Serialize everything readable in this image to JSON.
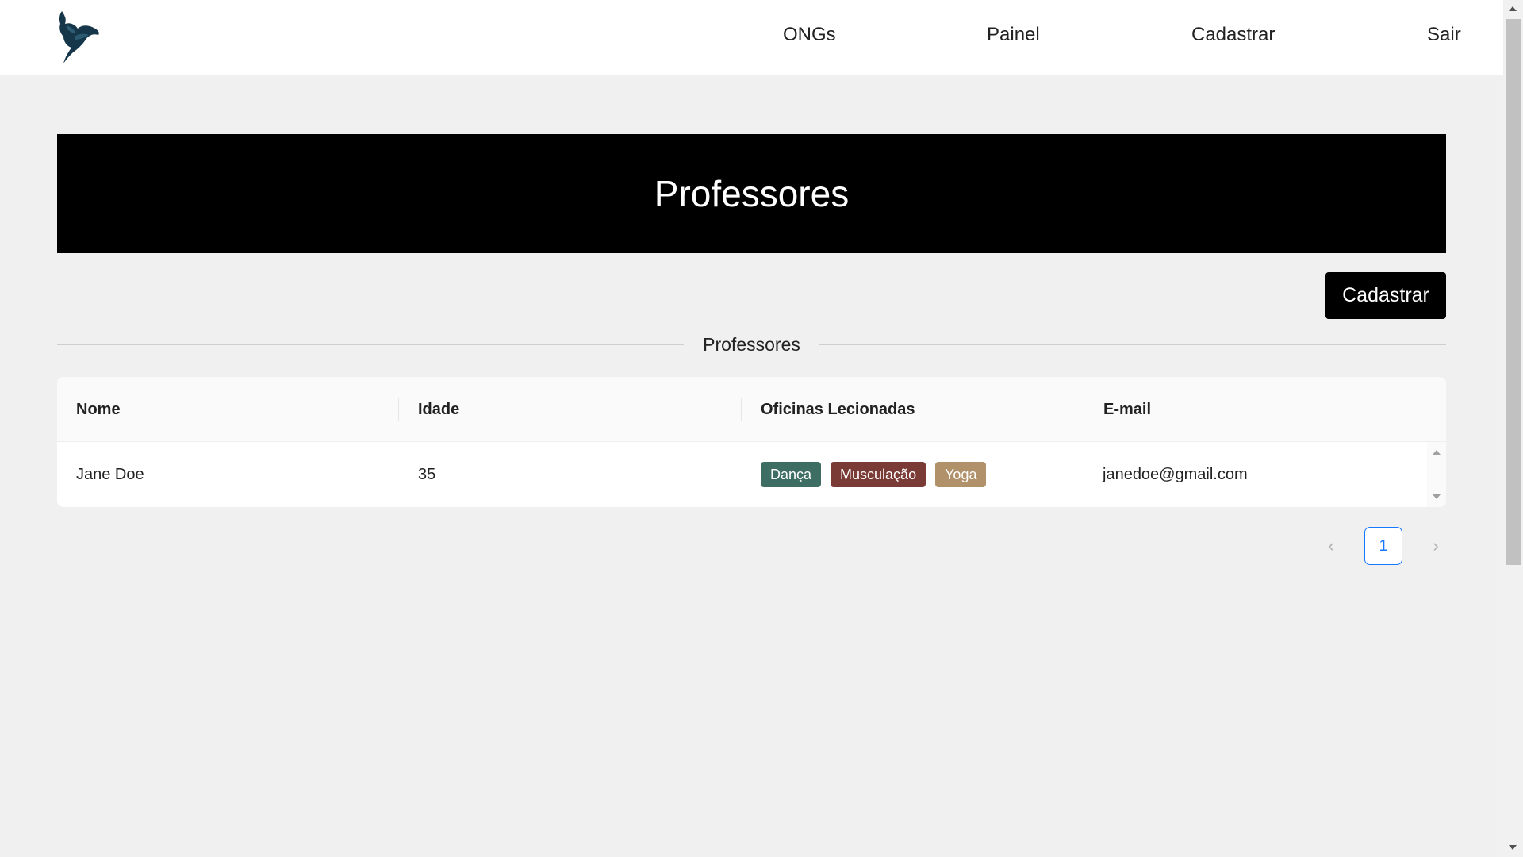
{
  "nav": {
    "logo": "bird-logo",
    "items": [
      {
        "label": "ONGs"
      },
      {
        "label": "Painel"
      },
      {
        "label": "Cadastrar"
      },
      {
        "label": "Sair"
      }
    ]
  },
  "banner": {
    "title": "Professores"
  },
  "actions": {
    "register_label": "Cadastrar"
  },
  "divider": {
    "title": "Professores"
  },
  "table": {
    "columns": [
      "Nome",
      "Idade",
      "Oficinas Lecionadas",
      "E-mail"
    ],
    "rows": [
      {
        "name": "Jane Doe",
        "age": "35",
        "workshops": [
          {
            "label": "Dança",
            "color": "#3e6e63"
          },
          {
            "label": "Musculação",
            "color": "#7a3a36"
          },
          {
            "label": "Yoga",
            "color": "#b0916a"
          }
        ],
        "email": "janedoe@gmail.com"
      }
    ]
  },
  "pagination": {
    "prev_icon": "chevron-left-icon",
    "current_page": "1",
    "next_icon": "chevron-right-icon"
  },
  "colors": {
    "accent": "#1677ff",
    "banner_bg": "#000000",
    "page_bg": "#f0f0f0"
  }
}
